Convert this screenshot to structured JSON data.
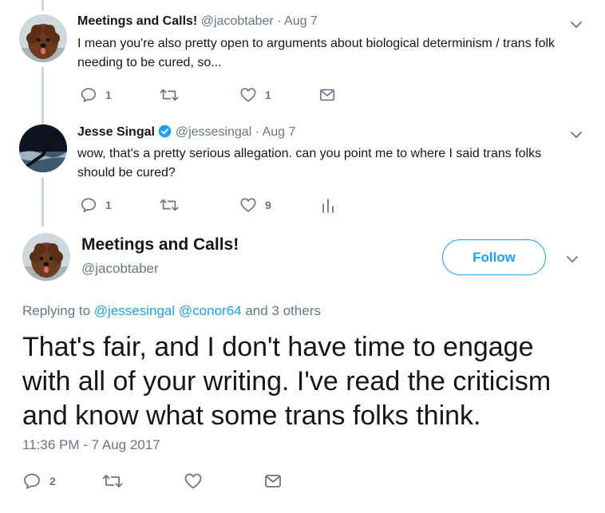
{
  "tweets": [
    {
      "name": "Meetings and Calls!",
      "handle": "@jacobtaber",
      "sep": "·",
      "date": "Aug 7",
      "text": "I mean you're also pretty open to arguments about biological determinism / trans folk needing to be cured, so...",
      "replies": "1",
      "retweets": "",
      "likes": "1"
    },
    {
      "name": "Jesse Singal",
      "handle": "@jessesingal",
      "sep": "·",
      "date": "Aug 7",
      "text": "wow, that's a pretty serious allegation. can you point me to where I said trans folks should be cured?",
      "replies": "1",
      "retweets": "",
      "likes": "9"
    }
  ],
  "main": {
    "name": "Meetings and Calls!",
    "handle": "@jacobtaber",
    "follow_label": "Follow",
    "replying_prefix": "Replying to",
    "mention1": "@jessesingal",
    "mention2": "@conor64",
    "replying_suffix": "and 3 others",
    "text": "That's fair, and I don't have time to engage with all of your writing. I've read the criticism and know what some trans folks think.",
    "timestamp": "11:36 PM - 7 Aug 2017",
    "replies": "2"
  },
  "colors": {
    "accent": "#1da1f2",
    "muted": "#657786",
    "thread": "#ccd6dd",
    "verified": "#1da1f2"
  },
  "icons": [
    "reply-icon",
    "retweet-icon",
    "like-icon",
    "message-icon",
    "analytics-icon",
    "chevron-down-icon",
    "verified-badge-icon"
  ]
}
